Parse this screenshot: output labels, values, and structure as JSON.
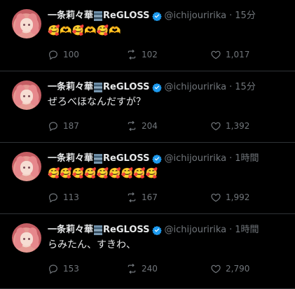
{
  "tweets": [
    {
      "name": "一条莉々華",
      "name_suffix": "ReGLOSS",
      "handle": "@ichijouririka",
      "dot": "·",
      "time": "15分",
      "text": "🥰🫶🥰🫶🥰🫶",
      "replies": "100",
      "retweets": "102",
      "likes": "1,017"
    },
    {
      "name": "一条莉々華",
      "name_suffix": "ReGLOSS",
      "handle": "@ichijouririka",
      "dot": "·",
      "time": "15分",
      "text": "ぜろべほなんだすが？",
      "replies": "187",
      "retweets": "204",
      "likes": "1,392"
    },
    {
      "name": "一条莉々華",
      "name_suffix": "ReGLOSS",
      "handle": "@ichijouririka",
      "dot": "·",
      "time": "1時間",
      "text": "🥰🥰🥰🥰🥰🥰🥰🥰🥰",
      "replies": "113",
      "retweets": "167",
      "likes": "1,992"
    },
    {
      "name": "一条莉々華",
      "name_suffix": "ReGLOSS",
      "handle": "@ichijouririka",
      "dot": "·",
      "time": "1時間",
      "text": "らみたん、すきわ、",
      "replies": "153",
      "retweets": "240",
      "likes": "2,790"
    }
  ],
  "colors": {
    "background": "#000000",
    "text": "#e7e9ea",
    "muted": "#71767b",
    "verified": "#1d9bf0",
    "divider": "#2f3336"
  }
}
